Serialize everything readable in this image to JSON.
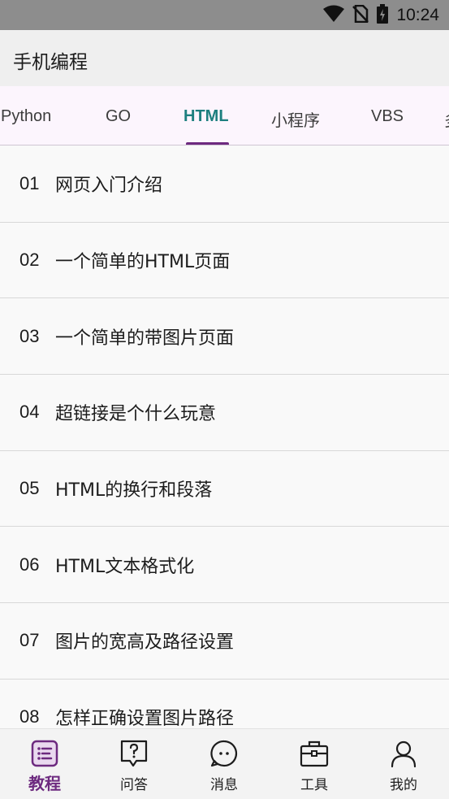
{
  "status_bar": {
    "time": "10:24",
    "icons": [
      "wifi-icon",
      "no-sim-icon",
      "battery-charging-icon"
    ]
  },
  "app_bar": {
    "title": "手机编程"
  },
  "tabs": [
    {
      "label": "Python",
      "active": false
    },
    {
      "label": "GO",
      "active": false
    },
    {
      "label": "HTML",
      "active": true
    },
    {
      "label": "小程序",
      "active": false
    },
    {
      "label": "VBS",
      "active": false
    },
    {
      "label": "多",
      "active": false
    }
  ],
  "lessons": [
    {
      "num": "01",
      "title": "网页入门介绍"
    },
    {
      "num": "02",
      "title": "一个简单的HTML页面"
    },
    {
      "num": "03",
      "title": "一个简单的带图片页面"
    },
    {
      "num": "04",
      "title": "超链接是个什么玩意"
    },
    {
      "num": "05",
      "title": "HTML的换行和段落"
    },
    {
      "num": "06",
      "title": "HTML文本格式化"
    },
    {
      "num": "07",
      "title": "图片的宽高及路径设置"
    },
    {
      "num": "08",
      "title": "怎样正确设置图片路径"
    }
  ],
  "bottom_nav": [
    {
      "label": "教程",
      "icon": "tutorial-list-icon",
      "active": true
    },
    {
      "label": "问答",
      "icon": "question-icon",
      "active": false
    },
    {
      "label": "消息",
      "icon": "message-icon",
      "active": false
    },
    {
      "label": "工具",
      "icon": "toolbox-icon",
      "active": false
    },
    {
      "label": "我的",
      "icon": "profile-icon",
      "active": false
    }
  ],
  "colors": {
    "accent": "#6d2a7f",
    "active_tab_text": "#1d7f7f",
    "status_bar": "#8d8d8d",
    "app_bar": "#efefef",
    "tab_bar": "#fcf5fd"
  }
}
